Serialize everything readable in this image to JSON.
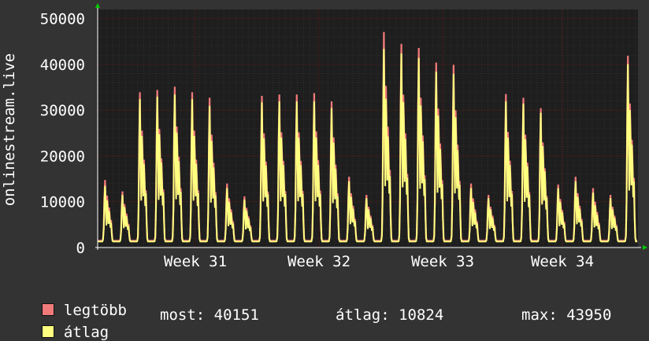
{
  "chart_data": {
    "type": "area",
    "ylabel": "onlinestream.live",
    "ylim": [
      0,
      52000
    ],
    "yticks": [
      0,
      10000,
      20000,
      30000,
      40000,
      50000
    ],
    "ytick_labels": [
      "0",
      "10000",
      "20000",
      "30000",
      "40000",
      "50000"
    ],
    "xticks": [
      "Week 31",
      "Week 32",
      "Week 33",
      "Week 34"
    ],
    "grid": true,
    "colors": {
      "background": "#333333",
      "plot": "#1e1e1e",
      "grid_major": "#5a1a1a",
      "grid_minor": "#3a3a3a",
      "axis_arrow": "#00cc00"
    },
    "series": [
      {
        "name": "legtöbb",
        "color": "#f07a7a",
        "daily_peaks": [
          14800,
          12300,
          34000,
          34500,
          35200,
          34000,
          32800,
          14000,
          11200,
          33200,
          33500,
          33500,
          33800,
          32000,
          15500,
          11500,
          47200,
          44600,
          43700,
          40500,
          40000,
          14000,
          11500,
          33600,
          32800,
          30500,
          13800,
          15500,
          13000,
          11500,
          42000
        ]
      },
      {
        "name": "átlag",
        "color": "#ffff80",
        "daily_peaks": [
          13500,
          11500,
          32500,
          33000,
          33500,
          32500,
          31000,
          13000,
          10500,
          31800,
          32000,
          32000,
          32000,
          30500,
          14500,
          10800,
          43500,
          42500,
          41500,
          38500,
          38000,
          13000,
          10800,
          32000,
          31500,
          29500,
          13000,
          14500,
          12000,
          10800,
          40151
        ]
      }
    ]
  },
  "legend": [
    {
      "label": "legtöbb",
      "color": "#f07a7a"
    },
    {
      "label": "átlag",
      "color": "#ffff80"
    }
  ],
  "stats": {
    "most": "most: 40151",
    "atlag": "átlag: 10824",
    "max": "max: 43950"
  }
}
